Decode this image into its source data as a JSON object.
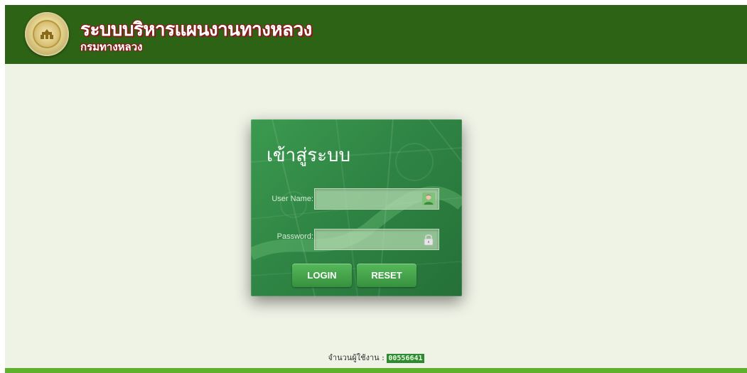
{
  "header": {
    "title": "ระบบบริหารแผนงานทางหลวง",
    "subtitle": "กรมทางหลวง",
    "background_color": "#2c6314",
    "logo_icon": "department-emblem-icon"
  },
  "login": {
    "heading": "เข้าสู่ระบบ",
    "username_label": "User Name:",
    "username_value": "",
    "username_icon": "user-avatar-icon",
    "password_label": "Password:",
    "password_value": "",
    "password_icon": "padlock-icon",
    "login_button": "LOGIN",
    "reset_button": "RESET",
    "panel_color": "#2f8544"
  },
  "footer": {
    "counter_label": "จำนวนผู้ใช้งาน :",
    "counter_value": "00556641",
    "bar_color": "#5fb02c"
  }
}
